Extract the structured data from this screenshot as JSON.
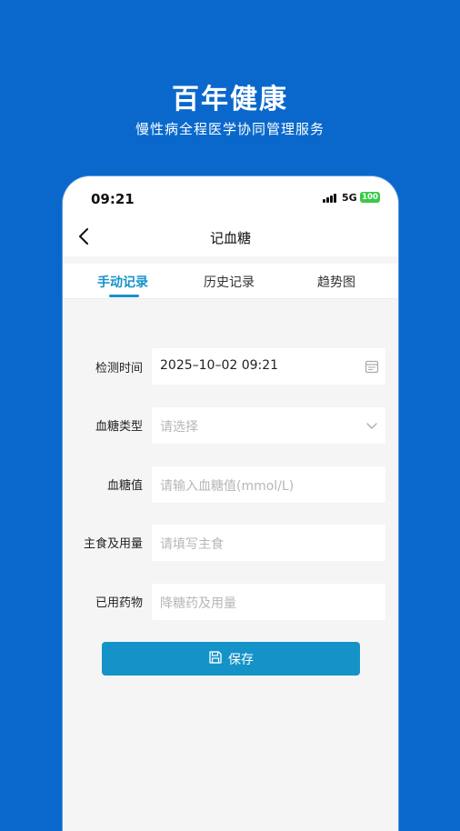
{
  "promo": {
    "title": "百年健康",
    "subtitle": "慢性病全程医学协同管理服务"
  },
  "status_bar": {
    "time": "09:21",
    "network": "5G",
    "battery": "100"
  },
  "nav": {
    "title": "记血糖",
    "back_icon": "chevron-left-icon"
  },
  "tabs": [
    {
      "label": "手动记录",
      "active": true
    },
    {
      "label": "历史记录",
      "active": false
    },
    {
      "label": "趋势图",
      "active": false
    }
  ],
  "form": {
    "time_label": "检测时间",
    "time_value": "2025–10–02 09:21",
    "type_label": "血糖类型",
    "type_placeholder": "请选择",
    "value_label": "血糖值",
    "value_placeholder": "请输入血糖值(mmol/L)",
    "food_label": "主食及用量",
    "food_placeholder": "请填写主食",
    "med_label": "已用药物",
    "med_placeholder": "降糖药及用量"
  },
  "save_button": {
    "label": "保存",
    "icon": "save-icon"
  },
  "colors": {
    "background": "#0a68cc",
    "accent": "#1593c8",
    "battery": "#3cc84a"
  }
}
